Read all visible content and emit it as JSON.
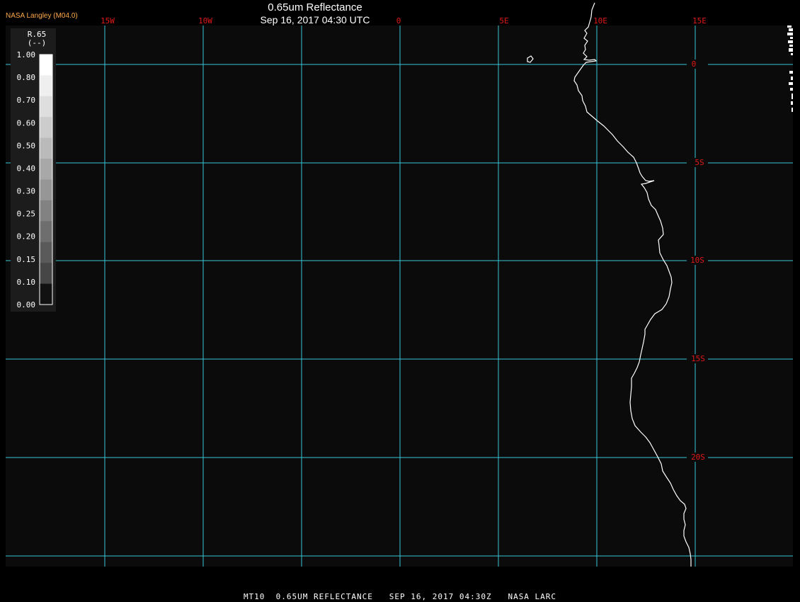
{
  "header": {
    "title": "0.65um Reflectance",
    "subtitle": "Sep 16, 2017 04:30 UTC",
    "agency": "NASA Langley (M04.0)"
  },
  "footer": {
    "text": "MT10  0.65UM REFLECTANCE   SEP 16, 2017 04:30Z   NASA LARC"
  },
  "colorbar": {
    "variable": "R.65",
    "units": "(--)",
    "ticks": [
      "1.00",
      "0.80",
      "0.70",
      "0.60",
      "0.50",
      "0.40",
      "0.30",
      "0.25",
      "0.20",
      "0.15",
      "0.10",
      "0.00"
    ],
    "fill_colors": [
      "#ffffff",
      "#efefef",
      "#dedede",
      "#cccccc",
      "#bababa",
      "#a8a8a8",
      "#969696",
      "#828282",
      "#6e6e6e",
      "#5a5a5a",
      "#464646",
      "#111111"
    ]
  },
  "map": {
    "longitude_labels": [
      "15W",
      "10W",
      "0",
      "5E",
      "10E",
      "15E"
    ],
    "latitude_labels": [
      "0",
      "5S",
      "10S",
      "15S",
      "20S"
    ],
    "colors": {
      "background": "#0b0b0b",
      "gridline": "#37c6d6",
      "label": "#e01818",
      "coastline": "#ffffff"
    }
  }
}
